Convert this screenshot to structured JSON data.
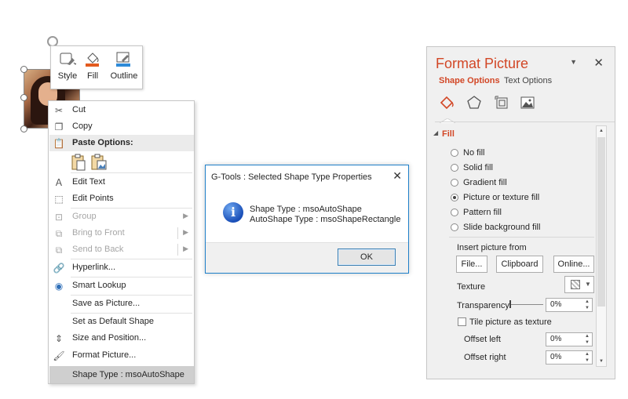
{
  "mini_toolbar": {
    "style_label": "Style",
    "fill_label": "Fill",
    "outline_label": "Outline"
  },
  "context_menu": {
    "cut": "Cut",
    "copy": "Copy",
    "paste_options": "Paste Options:",
    "edit_text": "Edit Text",
    "edit_points": "Edit Points",
    "group": "Group",
    "bring_to_front": "Bring to Front",
    "send_to_back": "Send to Back",
    "hyperlink": "Hyperlink...",
    "smart_lookup": "Smart Lookup",
    "save_as_picture": "Save as Picture...",
    "set_default_shape": "Set as Default Shape",
    "size_position": "Size and Position...",
    "format_picture": "Format Picture...",
    "shape_type": "Shape Type : msoAutoShape"
  },
  "dialog": {
    "title": "G-Tools : Selected Shape Type Properties",
    "line1": "Shape Type : msoAutoShape",
    "line2": "AutoShape Type : msoShapeRectangle",
    "ok": "OK"
  },
  "format_pane": {
    "title": "Format Picture",
    "tabs": [
      "Shape Options",
      "Text Options"
    ],
    "section": "Fill",
    "fill_options": [
      "No fill",
      "Solid fill",
      "Gradient fill",
      "Picture or texture fill",
      "Pattern fill",
      "Slide background fill"
    ],
    "selected_fill": "Picture or texture fill",
    "insert_from": "Insert picture from",
    "buttons": {
      "file": "File...",
      "clipboard": "Clipboard",
      "online": "Online..."
    },
    "texture": "Texture",
    "transparency": "Transparency",
    "transparency_value": "0%",
    "tile": "Tile picture as texture",
    "offset_left": "Offset left",
    "offset_left_value": "0%",
    "offset_right": "Offset right",
    "offset_right_value": "0%"
  },
  "colors": {
    "accent": "#d24726",
    "fill_bar": "#e35b1f",
    "outline_bar": "#2f8bd8",
    "dialog_border": "#1e7fc9"
  }
}
